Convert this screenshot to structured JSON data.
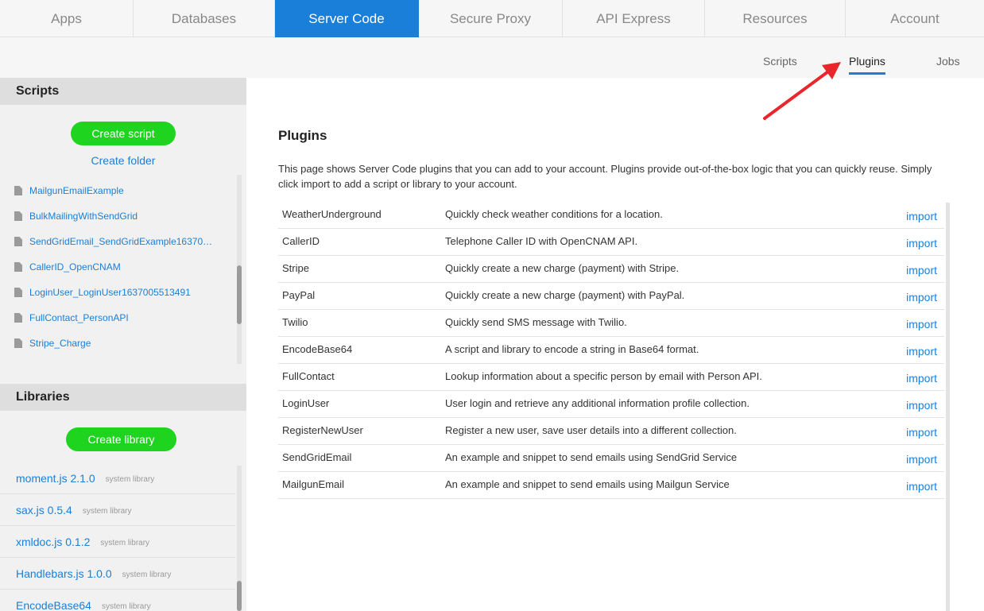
{
  "topnav": {
    "tabs": [
      {
        "label": "Apps"
      },
      {
        "label": "Databases"
      },
      {
        "label": "Server Code"
      },
      {
        "label": "Secure Proxy"
      },
      {
        "label": "API Express"
      },
      {
        "label": "Resources"
      },
      {
        "label": "Account"
      }
    ],
    "active_tab": "Server Code"
  },
  "subnav": {
    "items": [
      {
        "label": "Scripts"
      },
      {
        "label": "Plugins"
      },
      {
        "label": "Jobs"
      }
    ],
    "active_item": "Plugins"
  },
  "sidebar": {
    "scripts": {
      "title": "Scripts",
      "create_script_label": "Create script",
      "create_folder_label": "Create folder",
      "items": [
        {
          "label": "MailgunEmailExample"
        },
        {
          "label": "BulkMailingWithSendGrid"
        },
        {
          "label": "SendGridEmail_SendGridExample16370…"
        },
        {
          "label": "CallerID_OpenCNAM"
        },
        {
          "label": "LoginUser_LoginUser1637005513491"
        },
        {
          "label": "FullContact_PersonAPI"
        },
        {
          "label": "Stripe_Charge"
        }
      ]
    },
    "libraries": {
      "title": "Libraries",
      "create_library_label": "Create library",
      "items": [
        {
          "name": "moment.js 2.1.0",
          "type": "system library"
        },
        {
          "name": "sax.js 0.5.4",
          "type": "system library"
        },
        {
          "name": "xmldoc.js 0.1.2",
          "type": "system library"
        },
        {
          "name": "Handlebars.js 1.0.0",
          "type": "system library"
        },
        {
          "name": "EncodeBase64",
          "type": "system library"
        }
      ]
    }
  },
  "main": {
    "title": "Plugins",
    "description": "This page shows Server Code plugins that you can add to your account. Plugins provide out-of-the-box logic that you can quickly reuse. Simply click import to add a script or library to your account.",
    "plugins": [
      {
        "name": "WeatherUnderground",
        "description": "Quickly check weather conditions for a location.",
        "action": "import"
      },
      {
        "name": "CallerID",
        "description": "Telephone Caller ID with OpenCNAM API.",
        "action": "import"
      },
      {
        "name": "Stripe",
        "description": "Quickly create a new charge (payment) with Stripe.",
        "action": "import"
      },
      {
        "name": "PayPal",
        "description": "Quickly create a new charge (payment) with PayPal.",
        "action": "import"
      },
      {
        "name": "Twilio",
        "description": "Quickly send SMS message with Twilio.",
        "action": "import"
      },
      {
        "name": "EncodeBase64",
        "description": "A script and library to encode a string in Base64 format.",
        "action": "import"
      },
      {
        "name": "FullContact",
        "description": "Lookup information about a specific person by email with Person API.",
        "action": "import"
      },
      {
        "name": "LoginUser",
        "description": "User login and retrieve any additional information profile collection.",
        "action": "import"
      },
      {
        "name": "RegisterNewUser",
        "description": "Register a new user, save user details into a different collection.",
        "action": "import"
      },
      {
        "name": "SendGridEmail",
        "description": "An example and snippet to send emails using SendGrid Service",
        "action": "import"
      },
      {
        "name": "MailgunEmail",
        "description": "An example and snippet to send emails using Mailgun Service",
        "action": "import"
      }
    ]
  },
  "colors": {
    "accent": "#1a7fd8",
    "create_button": "#1ed41e",
    "annotation_arrow": "#e8262b"
  }
}
